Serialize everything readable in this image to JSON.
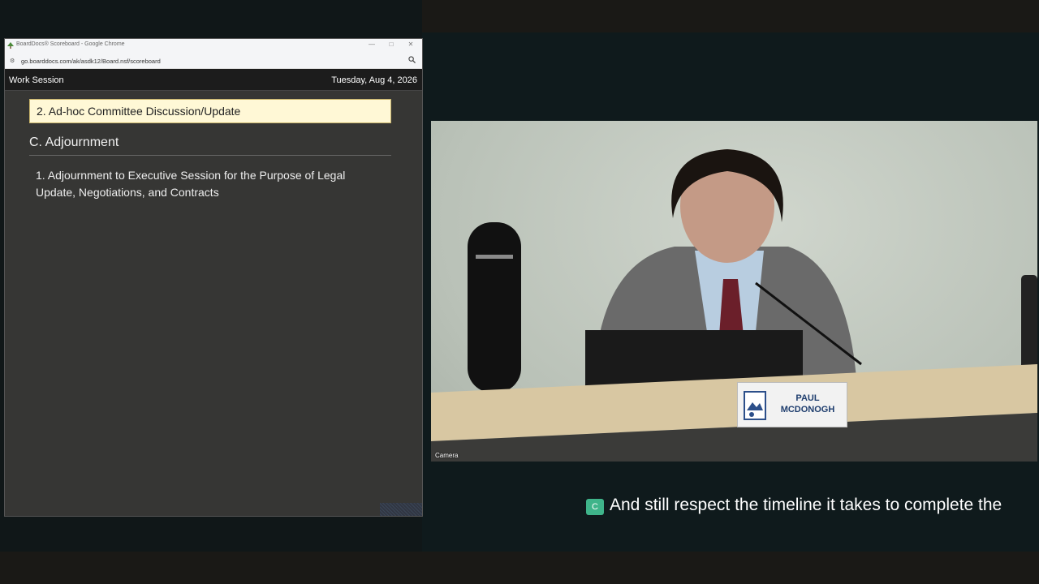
{
  "browser": {
    "window_title": "BoardDocs® Scoreboard - Google Chrome",
    "url": "go.boarddocs.com/ak/asdk12/Board.nsf/scoreboard",
    "controls": {
      "minimize": "—",
      "maximize": "□",
      "close": "✕"
    }
  },
  "page": {
    "session_label": "Work Session",
    "date": "Tuesday, Aug 4, 2026",
    "current_item": "2. Ad-hoc Committee Discussion/Update",
    "section_heading": "C. Adjournment",
    "items": [
      {
        "label": "1. Adjournment to Executive Session for the Purpose of Legal Update, Negotiations, and Contracts"
      }
    ]
  },
  "camera": {
    "label": "Camera",
    "nameplate_line1": "PAUL",
    "nameplate_line2": "MCDONOGH"
  },
  "caption": {
    "badge": "C",
    "text": "And still respect the timeline it takes to complete the"
  },
  "colors": {
    "highlight_bg": "#fff8d6",
    "caption_badge": "#3fb48a",
    "nameplate_text": "#1f3e6e"
  }
}
